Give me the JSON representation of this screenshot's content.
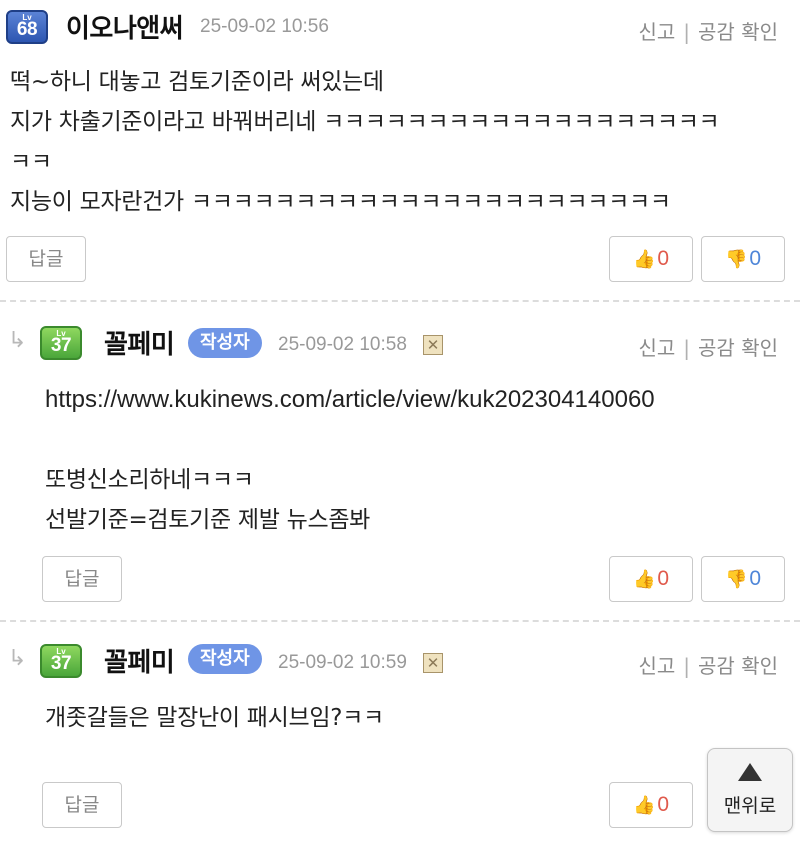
{
  "comments": [
    {
      "level_tag": "Lv",
      "level": "68",
      "nickname": "이오나앤써",
      "date": "25-09-02 10:56",
      "is_author": false,
      "report": "신고",
      "empathy": "공감 확인",
      "lines": [
        "떡~하니 대놓고 검토기준이라 써있는데",
        "지가 차출기준이라고 바꿔버리네 ㅋㅋㅋㅋㅋㅋㅋㅋㅋㅋㅋㅋㅋㅋㅋㅋㅋㅋㅋ",
        "ㅋㅋ",
        "지능이 모자란건가 ㅋㅋㅋㅋㅋㅋㅋㅋㅋㅋㅋㅋㅋㅋㅋㅋㅋㅋㅋㅋㅋㅋㅋ"
      ],
      "reply_label": "답글",
      "likes": "0",
      "dislikes": "0"
    },
    {
      "level_tag": "Lv",
      "level": "37",
      "nickname": "꼴페미",
      "author_tag": "작성자",
      "date": "25-09-02 10:58",
      "is_author": true,
      "report": "신고",
      "empathy": "공감 확인",
      "url": "https://www.kukinews.com/article/view/kuk202304140060",
      "lines": [
        "또병신소리하네ㅋㅋㅋ",
        "선발기준=검토기준 제발 뉴스좀봐"
      ],
      "reply_label": "답글",
      "likes": "0",
      "dislikes": "0"
    },
    {
      "level_tag": "Lv",
      "level": "37",
      "nickname": "꼴페미",
      "author_tag": "작성자",
      "date": "25-09-02 10:59",
      "is_author": true,
      "report": "신고",
      "empathy": "공감 확인",
      "lines": [
        "개좃갈들은 말장난이 패시브임?ㅋㅋ"
      ],
      "reply_label": "답글",
      "likes": "0"
    }
  ],
  "scroll_top": {
    "label": "맨위로",
    "icon": "up-triangle-icon"
  },
  "colors": {
    "like": "#e05a4c",
    "dislike": "#4f86d8",
    "author_tag": "#6f95e6",
    "level_68": "#2d56b1",
    "level_37": "#4aa63a"
  }
}
